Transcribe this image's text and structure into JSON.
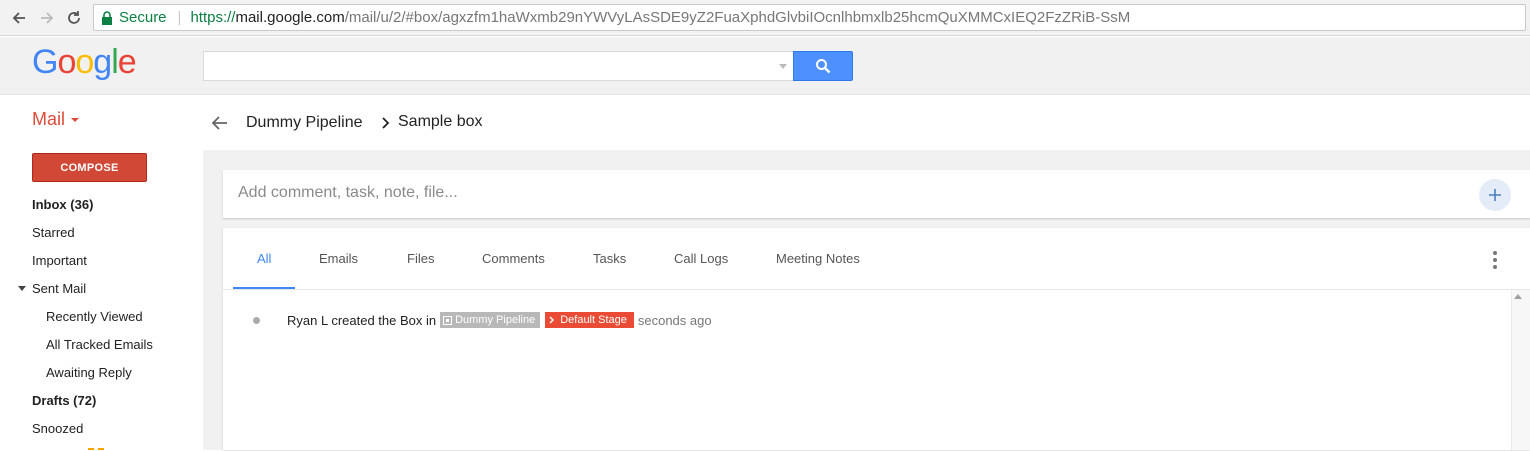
{
  "browser": {
    "secure_label": "Secure",
    "url_scheme": "https://",
    "url_host": "mail.google.com",
    "url_path": "/mail/u/2/#box/agxzfm1haWxmb29nYWVyLAsSDE9yZ2FuaXphdGlvbiIOcnlhbmxlb25hcmQuXMMCxIEQ2FzZRiB-SsM"
  },
  "logo": {
    "letters": [
      "G",
      "o",
      "o",
      "g",
      "l",
      "e"
    ],
    "colors": [
      "#4285f4",
      "#ea4335",
      "#fbbc05",
      "#4285f4",
      "#34a853",
      "#ea4335"
    ]
  },
  "search": {
    "value": "",
    "button_icon": "search-icon"
  },
  "leftnav": {
    "mail_label": "Mail",
    "compose_label": "COMPOSE",
    "items": [
      {
        "label": "Inbox (36)",
        "bold": true
      },
      {
        "label": "Starred",
        "bold": false
      },
      {
        "label": "Important",
        "bold": false
      },
      {
        "label": "Sent Mail",
        "bold": false
      },
      {
        "label": "Recently Viewed",
        "sub": true
      },
      {
        "label": "All Tracked Emails",
        "sub": true
      },
      {
        "label": "Awaiting Reply",
        "sub": true
      },
      {
        "label": "Drafts (72)",
        "bold": true
      },
      {
        "label": "Snoozed",
        "bold": false
      }
    ]
  },
  "breadcrumb": {
    "pipeline": "Dummy Pipeline",
    "box": "Sample box"
  },
  "comment": {
    "placeholder": "Add comment, task, note, file..."
  },
  "tabs": [
    "All",
    "Emails",
    "Files",
    "Comments",
    "Tasks",
    "Call Logs",
    "Meeting Notes"
  ],
  "active_tab": "All",
  "feed": {
    "text": "Ryan L created the Box in",
    "pipeline_chip": "Dummy Pipeline",
    "stage_chip": "Default Stage",
    "time": "seconds ago"
  },
  "colors": {
    "compose": "#d14836",
    "accent_blue": "#4285f4",
    "stage_red": "#e94b35",
    "secure_green": "#0b8043"
  }
}
